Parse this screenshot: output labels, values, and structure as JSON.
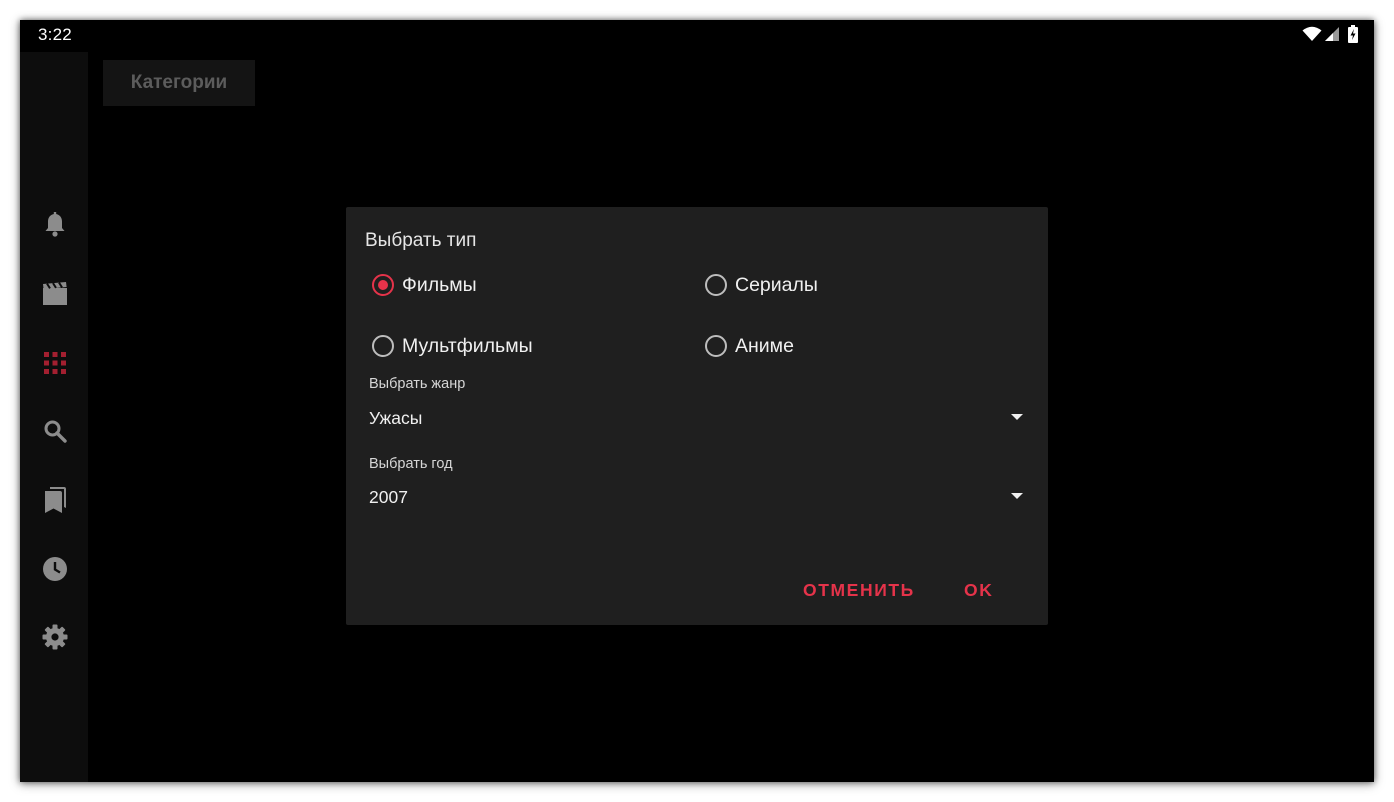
{
  "status_bar": {
    "time": "3:22",
    "icons": [
      "wifi-icon",
      "signal-icon",
      "battery-charging-icon"
    ]
  },
  "sidebar": {
    "items": [
      {
        "icon": "bell-icon",
        "active": false
      },
      {
        "icon": "movie-clapper-icon",
        "active": false
      },
      {
        "icon": "grid-icon",
        "active": true
      },
      {
        "icon": "search-icon",
        "active": false
      },
      {
        "icon": "bookmarks-icon",
        "active": false
      },
      {
        "icon": "clock-icon",
        "active": false
      },
      {
        "icon": "gear-icon",
        "active": false
      }
    ]
  },
  "header": {
    "title": "Категории"
  },
  "dialog": {
    "title": "Выбрать тип",
    "types": [
      {
        "label": "Фильмы",
        "checked": true
      },
      {
        "label": "Сериалы",
        "checked": false
      },
      {
        "label": "Мультфильмы",
        "checked": false
      },
      {
        "label": "Аниме",
        "checked": false
      }
    ],
    "genre": {
      "label": "Выбрать жанр",
      "value": "Ужасы"
    },
    "year": {
      "label": "Выбрать год",
      "value": "2007"
    },
    "cancel_label": "ОТМЕНИТЬ",
    "ok_label": "OK"
  },
  "colors": {
    "accent": "#e5334a",
    "dialog_bg": "#1f1f1f",
    "screen_bg": "#000000",
    "icon_inactive": "#8c8c8c"
  }
}
